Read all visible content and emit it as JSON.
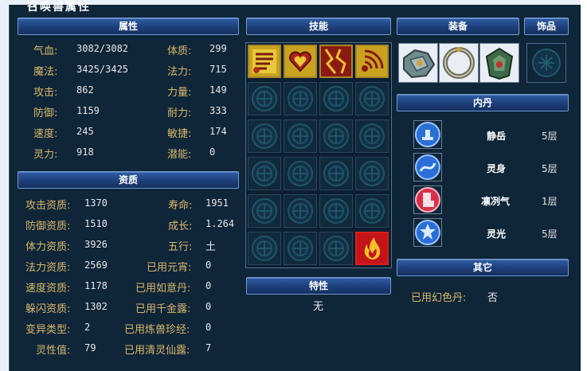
{
  "window": {
    "title": "召唤兽属性"
  },
  "sections": {
    "attributes": "属性",
    "skills": "技能",
    "equipment": "装备",
    "accessory": "饰品",
    "neidan": "内丹",
    "qualities": "资质",
    "traits": "特性",
    "other": "其它"
  },
  "attributes": {
    "left": [
      {
        "label": "气血:",
        "value": "3082/3082"
      },
      {
        "label": "魔法:",
        "value": "3425/3425"
      },
      {
        "label": "攻击:",
        "value": "862"
      },
      {
        "label": "防御:",
        "value": "1159"
      },
      {
        "label": "速度:",
        "value": "245"
      },
      {
        "label": "灵力:",
        "value": "918"
      }
    ],
    "right": [
      {
        "label": "体质:",
        "value": "299"
      },
      {
        "label": "法力:",
        "value": "715"
      },
      {
        "label": "力量:",
        "value": "149"
      },
      {
        "label": "耐力:",
        "value": "333"
      },
      {
        "label": "敏捷:",
        "value": "174"
      },
      {
        "label": "潜能:",
        "value": "0"
      }
    ]
  },
  "qualities": {
    "left": [
      {
        "label": "攻击资质:",
        "value": "1370"
      },
      {
        "label": "防御资质:",
        "value": "1510"
      },
      {
        "label": "体力资质:",
        "value": "3926"
      },
      {
        "label": "法力资质:",
        "value": "2569"
      },
      {
        "label": "速度资质:",
        "value": "1178"
      },
      {
        "label": "躲闪资质:",
        "value": "1302"
      },
      {
        "label": "变异类型:",
        "value": "2"
      },
      {
        "label": "灵性值:",
        "value": "79"
      }
    ],
    "right": [
      {
        "label": "寿命:",
        "value": "1951"
      },
      {
        "label": "成长:",
        "value": "1.264"
      },
      {
        "label": "五行:",
        "value": "土"
      },
      {
        "label": "已用元宵:",
        "value": "0"
      },
      {
        "label": "已用如意丹:",
        "value": "0"
      },
      {
        "label": "已用千金露:",
        "value": "0"
      },
      {
        "label": "已用炼兽珍经:",
        "value": "0"
      },
      {
        "label": "已用清灵仙露:",
        "value": "7"
      }
    ]
  },
  "skills": {
    "filled": [
      {
        "slot": 0,
        "icon": "skill-scroll-icon"
      },
      {
        "slot": 1,
        "icon": "skill-heart-icon"
      },
      {
        "slot": 2,
        "icon": "skill-crack-icon"
      },
      {
        "slot": 3,
        "icon": "skill-wave-icon"
      },
      {
        "slot": 23,
        "icon": "skill-flame-icon",
        "selected": true
      }
    ],
    "total_slots": 24
  },
  "traits": {
    "value": "无"
  },
  "equipment": [
    {
      "icon": "armor-equip-icon"
    },
    {
      "icon": "ring-equip-icon"
    },
    {
      "icon": "collar-equip-icon"
    }
  ],
  "neidan": [
    {
      "name": "静岳",
      "level": "5层",
      "color": "#2a6fd6"
    },
    {
      "name": "灵身",
      "level": "5层",
      "color": "#2a6fd6"
    },
    {
      "name": "凛冽气",
      "level": "1层",
      "color": "#d6304a"
    },
    {
      "name": "灵光",
      "level": "5层",
      "color": "#2a6fd6"
    }
  ],
  "other": {
    "label": "已用幻色丹:",
    "value": "否"
  }
}
